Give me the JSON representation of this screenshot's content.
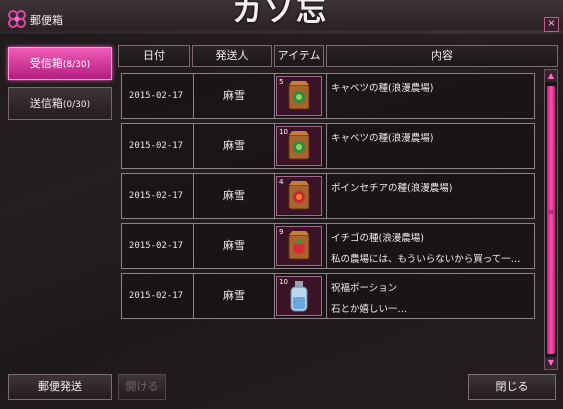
{
  "bg_title": "カソ忘",
  "window": {
    "title": "郵便箱",
    "close_label": "×"
  },
  "tabs": [
    {
      "label": "受信箱",
      "count": "(8/30)",
      "active": true
    },
    {
      "label": "送信箱",
      "count": "(0/30)",
      "active": false
    }
  ],
  "columns": [
    "日付",
    "発送人",
    "アイテム",
    "内容"
  ],
  "rows": [
    {
      "date": "2015-02-17",
      "sender": "麻雪",
      "qty": "5",
      "icon": "seed-bag-icon",
      "line1": "キャベツの種(浪漫農場)",
      "line2": ""
    },
    {
      "date": "2015-02-17",
      "sender": "麻雪",
      "qty": "10",
      "icon": "seed-bag-icon",
      "line1": "キャベツの種(浪漫農場)",
      "line2": ""
    },
    {
      "date": "2015-02-17",
      "sender": "麻雪",
      "qty": "4",
      "icon": "seed-bag-icon",
      "line1": "ポインセチアの種(浪漫農場)",
      "line2": ""
    },
    {
      "date": "2015-02-17",
      "sender": "麻雪",
      "qty": "9",
      "icon": "seed-bag-icon",
      "line1": "イチゴの種(浪漫農場)",
      "line2": "私の農場には、もういらないから買って一…"
    },
    {
      "date": "2015-02-17",
      "sender": "麻雪",
      "qty": "10",
      "icon": "potion-icon",
      "line1": "祝福ポーション",
      "line2": "石とか嬉しい一…"
    }
  ],
  "scroll": {
    "up": "▲",
    "down": "▼",
    "grip": "≡"
  },
  "buttons": {
    "send": "郵便発送",
    "open": "開ける",
    "close": "閉じる"
  },
  "colors": {
    "accent": "#e0339d",
    "panel": "#1e1a1c"
  }
}
